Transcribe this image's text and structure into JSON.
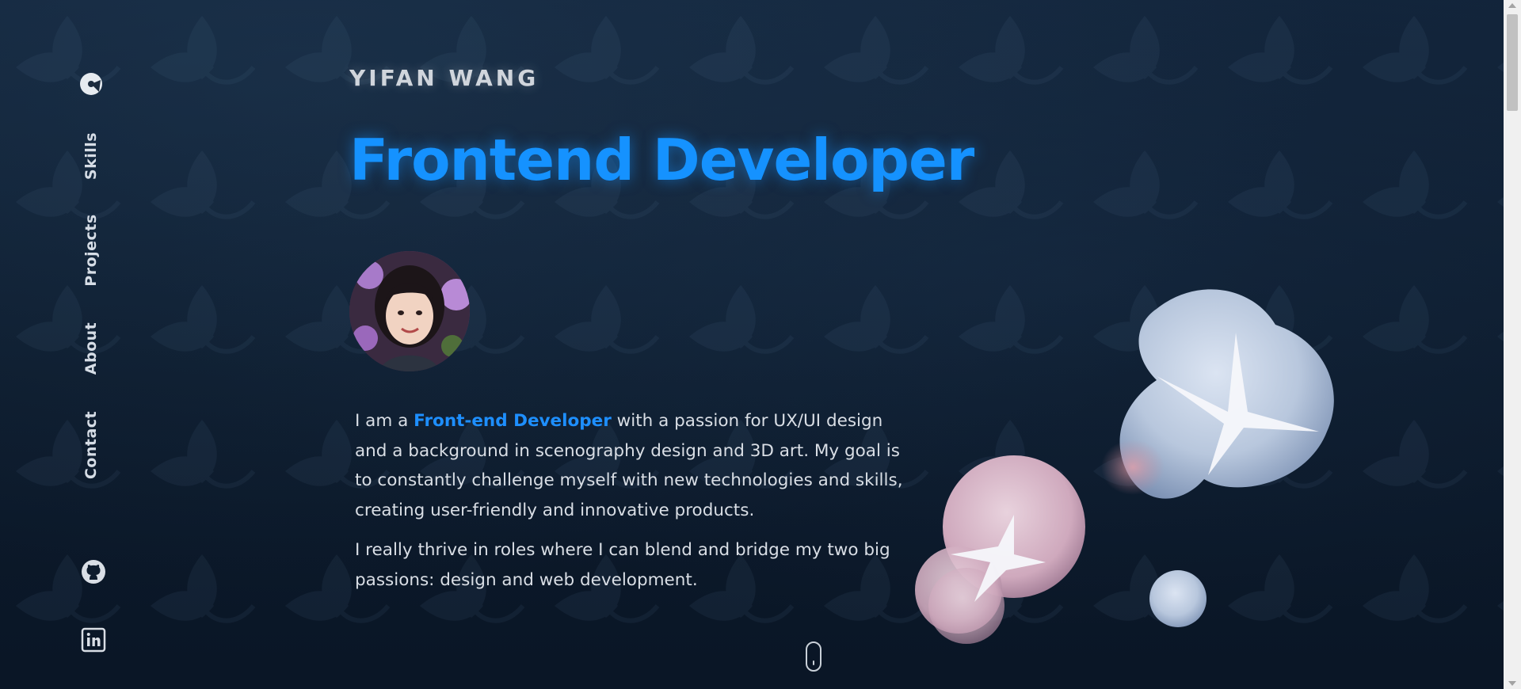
{
  "sidebar": {
    "logo_icon": "pacman-logo-icon",
    "nav": [
      {
        "label": "Skills"
      },
      {
        "label": "Projects"
      },
      {
        "label": "About"
      },
      {
        "label": "Contact"
      }
    ],
    "social": [
      {
        "icon": "github-icon"
      },
      {
        "icon": "linkedin-icon"
      }
    ]
  },
  "hero": {
    "name": "YIFAN WANG",
    "title": "Frontend Developer",
    "bio": {
      "p1_prefix": "I am a ",
      "p1_highlight": "Front-end Developer",
      "p1_suffix": " with a passion for UX/UI design and a background in scenography design and 3D art. My goal is to constantly challenge myself with new technologies and skills, creating user-friendly and innovative products.",
      "p2": "I really thrive in roles where I can blend and bridge my two big passions: design and web development."
    }
  },
  "colors": {
    "accent": "#1592ff",
    "background": "#0d1b2c",
    "text": "#d9dee5"
  }
}
